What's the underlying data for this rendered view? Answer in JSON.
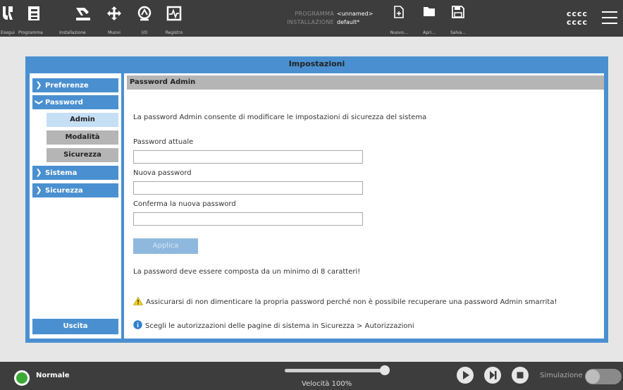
{
  "topbar": {
    "nav": [
      {
        "label": "Esegui",
        "icon": "ur-logo-icon"
      },
      {
        "label": "Programma",
        "icon": "program-icon"
      },
      {
        "label": "Installazione",
        "icon": "installation-icon"
      },
      {
        "label": "Muovi",
        "icon": "move-icon"
      },
      {
        "label": "I/O",
        "icon": "io-icon"
      },
      {
        "label": "Registro",
        "icon": "log-icon"
      }
    ],
    "program_key": "PROGRAMMA",
    "program_val": "<unnamed>",
    "install_key": "INSTALLAZIONE",
    "install_val": "default*",
    "file_actions": [
      {
        "label": "Nuovo...",
        "icon": "new-file-icon"
      },
      {
        "label": "Apri...",
        "icon": "folder-icon"
      },
      {
        "label": "Salva...",
        "icon": "save-icon"
      }
    ],
    "user_line1": "cccc",
    "user_line2": "cccc"
  },
  "dialog": {
    "title": "Impostazioni",
    "sidebar": {
      "preferences": "Preferenze",
      "password": "Password",
      "sub_items": [
        "Admin",
        "Modalità",
        "Sicurezza"
      ],
      "system": "Sistema",
      "security": "Sicurezza",
      "exit": "Uscita"
    },
    "content": {
      "header": "Password Admin",
      "description": "La password Admin consente di modificare le impostazioni di sicurezza del sistema",
      "current_label": "Password attuale",
      "new_label": "Nuova password",
      "confirm_label": "Conferma la nuova password",
      "apply": "Applica",
      "min_chars": "La password deve essere composta da un minimo di 8 caratteri!",
      "warning": "Assicurarsi di non dimenticare la propria password perché non è possibile recuperare una password Admin smarrita!",
      "info": "Scegli le autorizzazioni delle pagine di sistema in Sicurezza > Autorizzazioni"
    }
  },
  "bottombar": {
    "status": "Normale",
    "speed": "Velocità 100%",
    "speed_fraction": 1.0,
    "simulation": "Simulazione",
    "colors": {
      "status_green": "#3aaa35",
      "accent": "#4a90d0"
    }
  }
}
